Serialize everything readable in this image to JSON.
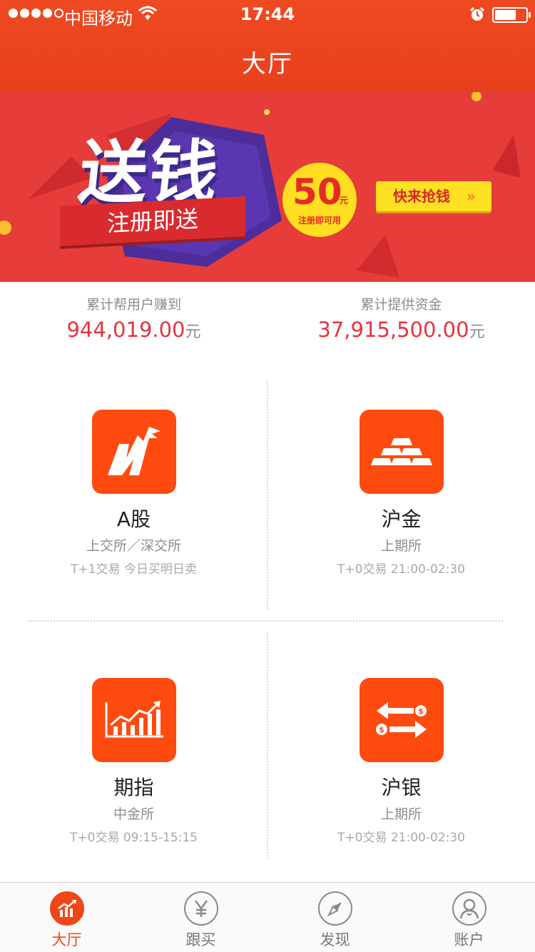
{
  "status_bar": {
    "carrier": "中国移动",
    "time": "17:44"
  },
  "nav": {
    "title": "大厅"
  },
  "banner": {
    "headline": "送钱",
    "ribbon_text": "注册即送",
    "badge_amount": "50",
    "badge_unit": "元",
    "badge_note": "注册即可用",
    "button_label": "快来抢钱",
    "button_chevron": "»"
  },
  "stats": [
    {
      "label": "累计帮用户赚到",
      "value": "944,019.00",
      "unit": "元"
    },
    {
      "label": "累计提供资金",
      "value": "37,915,500.00",
      "unit": "元"
    }
  ],
  "products": [
    {
      "name": "A股",
      "exchange": "上交所／深交所",
      "hours": "T+1交易 今日买明日卖",
      "icon": "stock-trend-icon"
    },
    {
      "name": "沪金",
      "exchange": "上期所",
      "hours": "T+0交易 21:00-02:30",
      "icon": "gold-bars-icon"
    },
    {
      "name": "期指",
      "exchange": "中金所",
      "hours": "T+0交易 09:15-15:15",
      "icon": "index-chart-icon"
    },
    {
      "name": "沪银",
      "exchange": "上期所",
      "hours": "T+0交易 21:00-02:30",
      "icon": "exchange-arrows-icon"
    }
  ],
  "tabs": [
    {
      "label": "大厅",
      "icon": "hall-chart-icon",
      "active": true
    },
    {
      "label": "跟买",
      "icon": "yen-icon",
      "active": false
    },
    {
      "label": "发现",
      "icon": "compass-icon",
      "active": false
    },
    {
      "label": "账户",
      "icon": "user-icon",
      "active": false
    }
  ],
  "colors": {
    "brand": "#ee4a22",
    "accent_red": "#e5343f",
    "icon_bg": "#ff4a10",
    "banner_bg": "#e63c3a",
    "badge_yellow": "#ffdf1f"
  }
}
